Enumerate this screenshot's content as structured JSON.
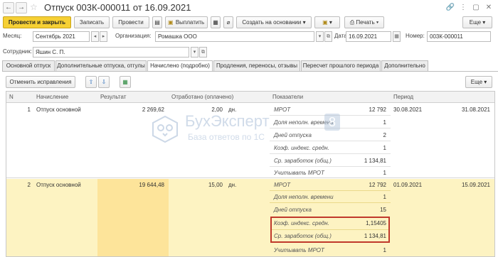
{
  "window": {
    "title": "Отпуск 003К-000011 от 16.09.2021"
  },
  "toolbar": {
    "post_close": "Провести и закрыть",
    "save": "Записать",
    "post": "Провести",
    "pay": "Выплатить",
    "create_based": "Создать на основании",
    "print": "Печать",
    "more": "Еще"
  },
  "form": {
    "month_label": "Месяц:",
    "month_value": "Сентябрь 2021",
    "org_label": "Организация:",
    "org_value": "Ромашка ООО",
    "date_label": "Дата:",
    "date_value": "16.09.2021",
    "number_label": "Номер:",
    "number_value": "003К-000011",
    "employee_label": "Сотрудник:",
    "employee_value": "Яшин С. П."
  },
  "tabs": [
    "Основной отпуск",
    "Дополнительные отпуска, отгулы",
    "Начислено (подробно)",
    "Продления, переносы, отзывы",
    "Пересчет прошлого периода",
    "Дополнительно"
  ],
  "subtoolbar": {
    "cancel_fix": "Отменить исправления",
    "more": "Еще"
  },
  "table": {
    "headers": [
      "N",
      "Начисление",
      "Результат",
      "Отработано (оплачено)",
      "Показатели",
      "Период"
    ],
    "rows": [
      {
        "n": "1",
        "accrual": "Отпуск основной",
        "result": "2 269,62",
        "worked": "2,00",
        "unit": "дн.",
        "indicators": [
          {
            "name": "МРОТ",
            "value": "12 792"
          },
          {
            "name": "Доля неполн. времени",
            "value": "1"
          },
          {
            "name": "Дней отпуска",
            "value": "2"
          },
          {
            "name": "Коэф. индекс. средн.",
            "value": "1"
          },
          {
            "name": "Ср. заработок (общ.)",
            "value": "1 134,81"
          },
          {
            "name": "Учитывать МРОТ",
            "value": "1"
          }
        ],
        "period_start": "30.08.2021",
        "period_end": "31.08.2021"
      },
      {
        "n": "2",
        "accrual": "Отпуск основной",
        "result": "19 644,48",
        "worked": "15,00",
        "unit": "дн.",
        "indicators": [
          {
            "name": "МРОТ",
            "value": "12 792"
          },
          {
            "name": "Доля неполн. времени",
            "value": "1"
          },
          {
            "name": "Дней отпуска",
            "value": "15"
          },
          {
            "name": "Коэф. индекс. средн.",
            "value": "1,15405"
          },
          {
            "name": "Ср. заработок (общ.)",
            "value": "1 134,81"
          },
          {
            "name": "Учитывать МРОТ",
            "value": "1"
          }
        ],
        "period_start": "01.09.2021",
        "period_end": "15.09.2021"
      }
    ]
  },
  "watermark": {
    "brand": "БухЭксперт",
    "digit": "8",
    "tagline": "База ответов по 1С"
  },
  "colors": {
    "primary_button": "#f6d034",
    "selected_row": "#fdf3c2",
    "selected_cell": "#fde49a",
    "highlight_box": "#c0392b"
  }
}
